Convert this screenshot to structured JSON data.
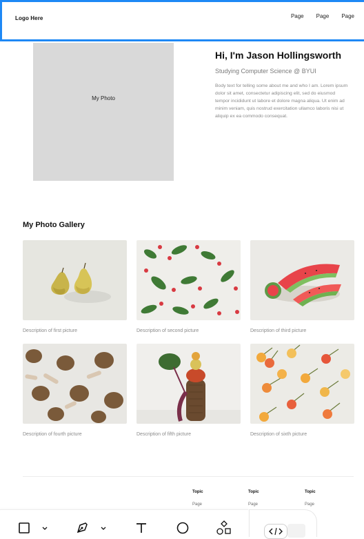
{
  "header": {
    "logo": "Logo Here",
    "nav": [
      "Page",
      "Page",
      "Page"
    ]
  },
  "hero": {
    "photo_label": "My Photo",
    "title": "Hi, I'm Jason Hollingsworth",
    "subtitle": "Studying Computer Science @ BYUI",
    "body": "Body text for telling some about me and who I am. Lorem ipsum dolor sit amet, consectetur adipiscing elit, sed do eiusmod tempor incididunt ut labore et dolore magna aliqua. Ut enim ad minim veniam, quis nostrud exercitation ullamco laboris nisi ut aliquip ex ea commodo consequat."
  },
  "gallery": {
    "title": "My Photo Gallery",
    "items": [
      {
        "desc": "Description of first picture"
      },
      {
        "desc": "Description of second picture"
      },
      {
        "desc": "Description of third picture"
      },
      {
        "desc": "Description of fourth picture"
      },
      {
        "desc": "Description of fifth picture"
      },
      {
        "desc": "Description of sixth picture"
      }
    ]
  },
  "footer": {
    "columns": [
      {
        "topic": "Topic",
        "link": "Page"
      },
      {
        "topic": "Topic",
        "link": "Page"
      },
      {
        "topic": "Topic",
        "link": "Page"
      }
    ]
  },
  "toolbar": {
    "tools": [
      "rectangle-icon",
      "chevron-down-icon",
      "pen-icon",
      "chevron-down-icon",
      "text-icon",
      "ellipse-icon",
      "shapes-icon"
    ],
    "code_icon": "code-icon"
  },
  "colors": {
    "accent": "#1e88f5",
    "photo_placeholder": "#d9d9d9",
    "muted_text": "#8a8a8a"
  }
}
